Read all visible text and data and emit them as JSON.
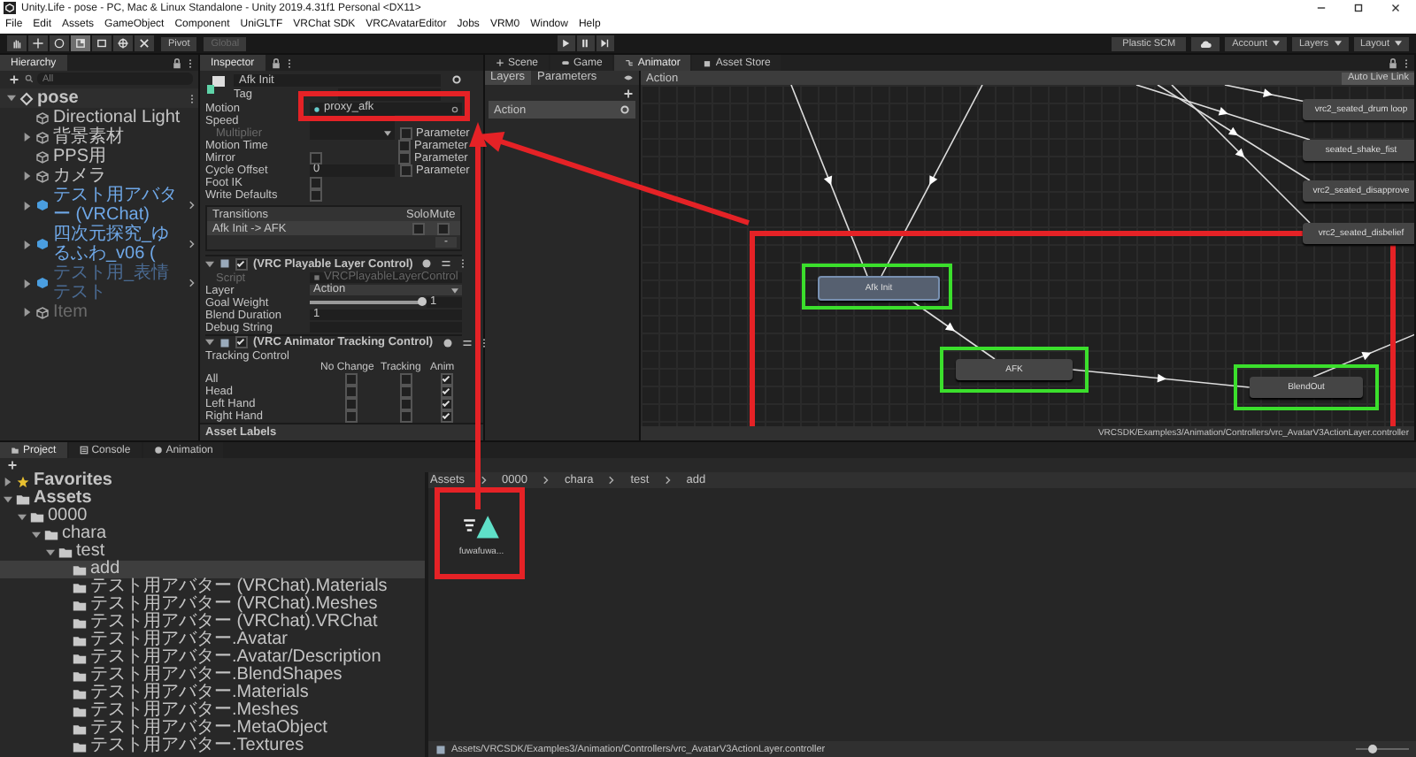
{
  "window": {
    "title": "Unity.Life - pose - PC, Mac & Linux Standalone - Unity 2019.4.31f1 Personal <DX11>"
  },
  "menu": [
    "File",
    "Edit",
    "Assets",
    "GameObject",
    "Component",
    "UniGLTF",
    "VRChat SDK",
    "VRCAvatarEditor",
    "Jobs",
    "VRM0",
    "Window",
    "Help"
  ],
  "toolbar": {
    "tools": [
      {
        "kind": "hand",
        "selected": false
      },
      {
        "kind": "move",
        "selected": false
      },
      {
        "kind": "rotate",
        "selected": false
      },
      {
        "kind": "scale",
        "selected": true
      },
      {
        "kind": "rect",
        "selected": false
      },
      {
        "kind": "transform",
        "selected": false
      },
      {
        "kind": "custom",
        "selected": false
      }
    ],
    "pivot": {
      "label": "Pivot",
      "disabled": false
    },
    "global": {
      "label": "Global",
      "disabled": true
    },
    "play": [
      {
        "kind": "play"
      },
      {
        "kind": "pause"
      },
      {
        "kind": "step"
      }
    ],
    "plastic": "Plastic SCM",
    "account": "Account",
    "layers": "Layers",
    "layout": "Layout"
  },
  "hierarchy": {
    "title": "Hierarchy",
    "search_placeholder": "All",
    "items": [
      {
        "label": "pose",
        "kind": "scene",
        "expanded": true,
        "children": [
          {
            "label": "Directional Light",
            "kind": "object"
          },
          {
            "label": "背景素材",
            "kind": "object",
            "expanded": false
          },
          {
            "label": "PPS用",
            "kind": "object"
          },
          {
            "label": "カメラ",
            "kind": "object",
            "expanded": false
          },
          {
            "label": "テスト用アバター (VRChat)",
            "kind": "prefab",
            "expanded": false
          },
          {
            "label": "四次元探究_ゆるふわ_v06 (",
            "kind": "prefab",
            "expanded": false
          },
          {
            "label": "テスト用_表情テスト",
            "kind": "prefab_inactive",
            "expanded": false
          },
          {
            "label": "Item",
            "kind": "inactive",
            "expanded": false
          }
        ]
      }
    ]
  },
  "inspector": {
    "title": "Inspector",
    "name": "Afk Init",
    "tag_label": "Tag",
    "fields": [
      {
        "kind": "object",
        "label": "Motion",
        "value": "proxy_afk",
        "disabled": false
      },
      {
        "kind": "number",
        "label": "Speed",
        "disabled": false
      },
      {
        "kind": "dropdown",
        "label": "Multiplier",
        "disabled": true,
        "parameter": {
          "label": "Parameter",
          "checked": false
        }
      },
      {
        "kind": "none",
        "label": "Motion Time",
        "disabled": false,
        "parameter": {
          "label": "Parameter",
          "checked": false
        }
      },
      {
        "kind": "checkbox",
        "label": "Mirror",
        "checked": false,
        "disabled": false,
        "parameter": {
          "label": "Parameter",
          "checked": false
        }
      },
      {
        "kind": "number",
        "label": "Cycle Offset",
        "value": "0",
        "disabled": false,
        "parameter": {
          "label": "Parameter",
          "checked": false
        }
      },
      {
        "kind": "checkbox",
        "label": "Foot IK",
        "checked": false,
        "disabled": false
      },
      {
        "kind": "checkbox",
        "label": "Write Defaults",
        "checked": false,
        "disabled": false
      }
    ],
    "transitions": {
      "title": "Transitions",
      "solo": "Solo",
      "mute": "Mute",
      "rows": [
        {
          "label": "Afk Init -> AFK",
          "solo": false,
          "mute": false
        }
      ],
      "remove": "-"
    },
    "components": [
      {
        "kind": "fields",
        "title": "(VRC Playable Layer Control)",
        "enabled": true,
        "fields": [
          {
            "kind": "script",
            "label": "Script",
            "value": "VRCPlayableLayerControl",
            "disabled": true
          },
          {
            "kind": "dropdown",
            "label": "Layer",
            "value": "Action",
            "disabled": false
          },
          {
            "kind": "slider",
            "label": "Goal Weight",
            "level": 1,
            "value": "1",
            "disabled": false
          },
          {
            "kind": "number",
            "label": "Blend Duration",
            "value": "1",
            "disabled": false
          },
          {
            "kind": "text",
            "label": "Debug String",
            "disabled": false
          }
        ]
      },
      {
        "kind": "tracking",
        "title": "(VRC Animator Tracking Control)",
        "enabled": true,
        "label": "Tracking Control",
        "columns": [
          "No Change",
          "Tracking",
          "Anim"
        ],
        "rows": [
          {
            "label": "All",
            "checks": [
              false,
              false,
              true
            ]
          },
          {
            "label": "Head",
            "checks": [
              false,
              false,
              true
            ]
          },
          {
            "label": "Left Hand",
            "checks": [
              false,
              false,
              true
            ]
          },
          {
            "label": "Right Hand",
            "checks": [
              false,
              false,
              true
            ]
          }
        ]
      }
    ],
    "asset_labels": "Asset Labels"
  },
  "animator": {
    "tabs": [
      {
        "label": "Scene",
        "kind": "scene",
        "selected": false
      },
      {
        "label": "Game",
        "kind": "game",
        "selected": false
      },
      {
        "label": "Animator",
        "kind": "animator",
        "selected": true
      },
      {
        "label": "Asset Store",
        "kind": "store",
        "selected": false
      }
    ],
    "layer_tabs": [
      {
        "label": "Layers",
        "selected": true
      },
      {
        "label": "Parameters",
        "selected": false
      }
    ],
    "layers": [
      {
        "label": "Action",
        "selected": true
      }
    ],
    "breadcrumb": "Action",
    "live_link": "Auto Live Link",
    "nodes": [
      {
        "label": "Afk Init",
        "selected": true
      },
      {
        "label": "AFK",
        "selected": false
      },
      {
        "label": "BlendOut",
        "selected": false
      },
      {
        "label": "vrc2_seated_drum loop",
        "selected": false
      },
      {
        "label": "seated_shake_fist",
        "selected": false
      },
      {
        "label": "vrc2_seated_disapprove",
        "selected": false
      },
      {
        "label": "vrc2_seated_disbelief",
        "selected": false
      }
    ],
    "path": "VRCSDK/Examples3/Animation/Controllers/vrc_AvatarV3ActionLayer.controller"
  },
  "project": {
    "tabs": [
      {
        "label": "Project",
        "kind": "project",
        "selected": true
      },
      {
        "label": "Console",
        "kind": "console",
        "selected": false
      },
      {
        "label": "Animation",
        "kind": "animation",
        "selected": false
      }
    ],
    "tree": [
      {
        "label": "Favorites",
        "kind": "favorites",
        "expanded": false,
        "selected": false
      },
      {
        "label": "Assets",
        "kind": "folder",
        "expanded": true,
        "selected": false,
        "children": [
          {
            "label": "0000",
            "kind": "folder",
            "expanded": true,
            "selected": false,
            "children": [
              {
                "label": "chara",
                "kind": "folder",
                "expanded": true,
                "selected": false,
                "children": [
                  {
                    "label": "test",
                    "kind": "folder",
                    "expanded": true,
                    "selected": false,
                    "children": [
                      {
                        "label": "add",
                        "kind": "folder",
                        "selected": true
                      },
                      {
                        "label": "テスト用アバター (VRChat).Materials",
                        "kind": "folder",
                        "selected": false
                      },
                      {
                        "label": "テスト用アバター (VRChat).Meshes",
                        "kind": "folder",
                        "selected": false
                      },
                      {
                        "label": "テスト用アバター (VRChat).VRChat",
                        "kind": "folder",
                        "selected": false
                      },
                      {
                        "label": "テスト用アバター.Avatar",
                        "kind": "folder",
                        "selected": false
                      },
                      {
                        "label": "テスト用アバター.Avatar/Description",
                        "kind": "folder",
                        "selected": false
                      },
                      {
                        "label": "テスト用アバター.BlendShapes",
                        "kind": "folder",
                        "selected": false
                      },
                      {
                        "label": "テスト用アバター.Materials",
                        "kind": "folder",
                        "selected": false
                      },
                      {
                        "label": "テスト用アバター.Meshes",
                        "kind": "folder",
                        "selected": false
                      },
                      {
                        "label": "テスト用アバター.MetaObject",
                        "kind": "folder",
                        "selected": false
                      },
                      {
                        "label": "テスト用アバター.Textures",
                        "kind": "folder",
                        "selected": false
                      }
                    ]
                  }
                ]
              }
            ]
          }
        ]
      }
    ],
    "breadcrumb": [
      "Assets",
      "0000",
      "chara",
      "test",
      "add"
    ],
    "assets": [
      {
        "label": "fuwafuwa..."
      }
    ],
    "path": "Assets/VRCSDK/Examples3/Animation/Controllers/vrc_AvatarV3ActionLayer.controller",
    "size_slider": {
      "level": 0.3
    }
  }
}
